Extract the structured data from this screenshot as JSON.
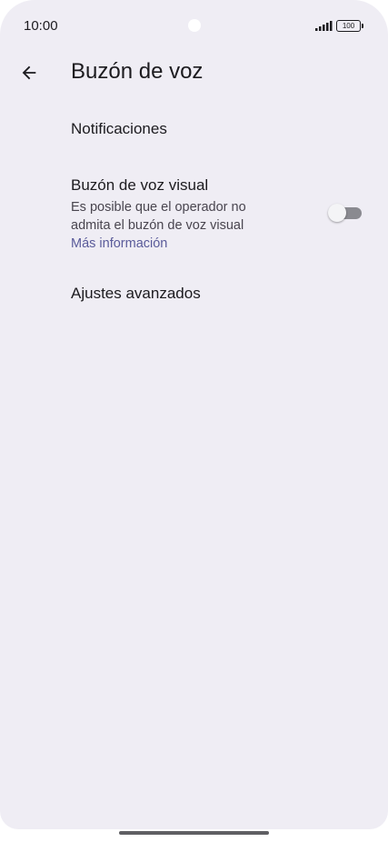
{
  "status_bar": {
    "time": "10:00",
    "battery_level": "100",
    "signal_icon": "signal-bars-icon",
    "battery_icon": "battery-icon"
  },
  "app_bar": {
    "back_icon": "arrow-back-icon",
    "title": "Buzón de voz"
  },
  "settings": {
    "notifications": {
      "title": "Notificaciones"
    },
    "visual_voicemail": {
      "title": "Buzón de voz visual",
      "summary": "Es posible que el operador no admita el buzón de voz visual",
      "link": "Más información",
      "enabled": false
    },
    "advanced": {
      "title": "Ajustes avanzados"
    }
  },
  "colors": {
    "background": "#efedf4",
    "text_primary": "#1c1b1f",
    "text_secondary": "#49454f",
    "link": "#5a5b9a",
    "toggle_track_off": "#8a8a90"
  }
}
